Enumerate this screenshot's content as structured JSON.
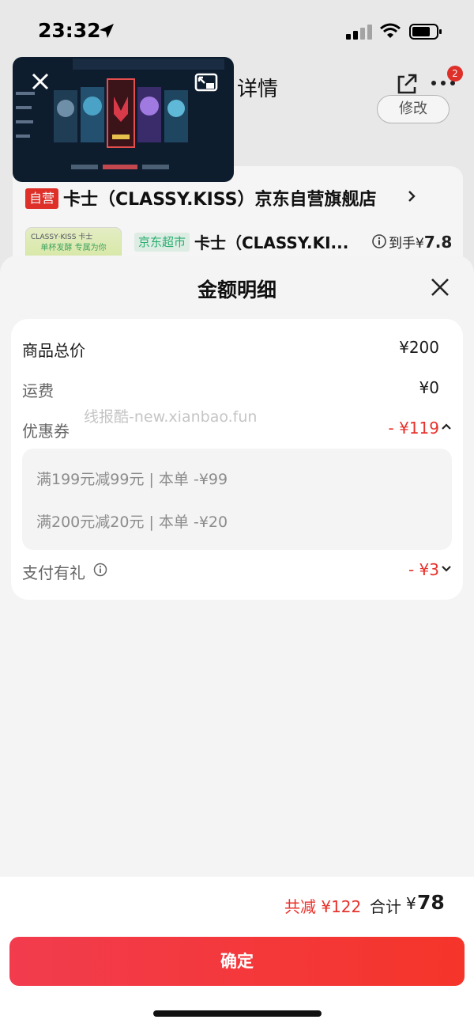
{
  "status_bar": {
    "time": "23:32"
  },
  "background_page": {
    "title": "详情",
    "badge_count": "2",
    "modify_button": "修改",
    "store": {
      "tag": "自营",
      "name": "卡士（CLASSY.KISS）京东自营旗舰店"
    },
    "product": {
      "tag": "京东超市",
      "name": "卡士（CLASSY.KI...",
      "arrive_label": "到手¥",
      "arrive_price": "7.8",
      "thumb_brand": "CLASSY·KISS 卡士",
      "thumb_slogan": "单杯发酵 专属为你"
    }
  },
  "sheet": {
    "title": "金额明细",
    "rows": {
      "goods_total": {
        "label": "商品总价",
        "value": "¥200"
      },
      "shipping": {
        "label": "运费",
        "value": "¥0"
      },
      "coupon": {
        "label": "优惠券",
        "value": "- ¥119"
      },
      "pay_gift": {
        "label": "支付有礼",
        "value": "- ¥3"
      }
    },
    "coupons": [
      "满199元减99元 | 本单 -¥99",
      "满200元减20元 | 本单 -¥20"
    ],
    "watermark": "线报酷-new.xianbao.fun"
  },
  "footer": {
    "saved": "共减 ¥122",
    "total_label": "合计",
    "total_yen": "¥",
    "total_value": "78",
    "confirm": "确定"
  },
  "colors": {
    "accent_red": "#e8312b",
    "confirm_gradient_start": "#f23c4e",
    "confirm_gradient_end": "#f5352a"
  },
  "icons": [
    "location-arrow-icon",
    "signal-icon",
    "wifi-icon",
    "battery-icon",
    "share-icon",
    "more-icon",
    "chevron-right-icon",
    "info-icon",
    "close-icon",
    "pip-expand-icon",
    "chevron-up-icon",
    "chevron-down-icon"
  ]
}
